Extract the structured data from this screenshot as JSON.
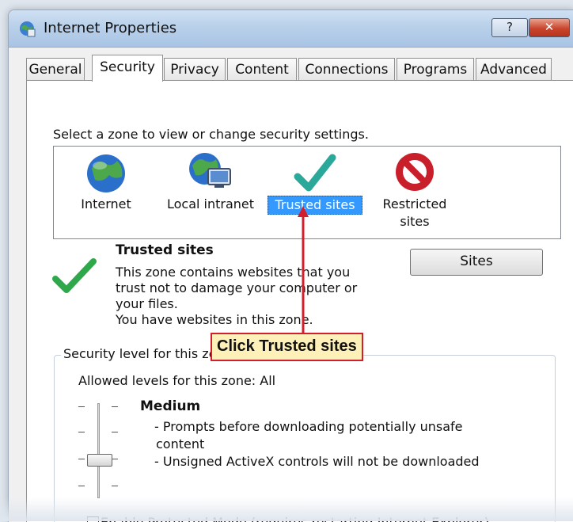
{
  "window": {
    "title": "Internet Properties",
    "help_label": "?",
    "close_label": "✕"
  },
  "tabs": [
    {
      "label": "General"
    },
    {
      "label": "Security"
    },
    {
      "label": "Privacy"
    },
    {
      "label": "Content"
    },
    {
      "label": "Connections"
    },
    {
      "label": "Programs"
    },
    {
      "label": "Advanced"
    }
  ],
  "active_tab": "Security",
  "zones": {
    "prompt": "Select a zone to view or change security settings.",
    "items": [
      {
        "label": "Internet",
        "icon": "globe-icon"
      },
      {
        "label": "Local intranet",
        "icon": "globe-monitor-icon"
      },
      {
        "label": "Trusted sites",
        "icon": "checkmark-icon"
      },
      {
        "label": "Restricted sites",
        "label_line1": "Restricted",
        "label_line2": "sites",
        "icon": "prohibited-icon"
      }
    ],
    "selected": "Trusted sites"
  },
  "details": {
    "title": "Trusted sites",
    "desc_lines": [
      "This zone contains websites that you",
      "trust not to damage your computer or",
      "your files.",
      "You have websites in this zone."
    ],
    "sites_button": "Sites"
  },
  "security_level": {
    "legend": "Security level for this zone",
    "allowed": "Allowed levels for this zone: All",
    "level_name": "Medium",
    "bullets_line1": "- Prompts before downloading potentially unsafe",
    "bullets_line2": "content",
    "bullets_line3": "- Unsigned ActiveX controls will not be downloaded"
  },
  "protected_mode": {
    "label": "Enable Protected Mode (requires restarting Internet Explorer)",
    "checked": false
  },
  "callout": {
    "text": "Click Trusted sites"
  },
  "colors": {
    "selection": "#3399ff",
    "callout_border": "#d21f2e",
    "callout_fill": "#fdf0b8",
    "check_green": "#2ea84a"
  }
}
